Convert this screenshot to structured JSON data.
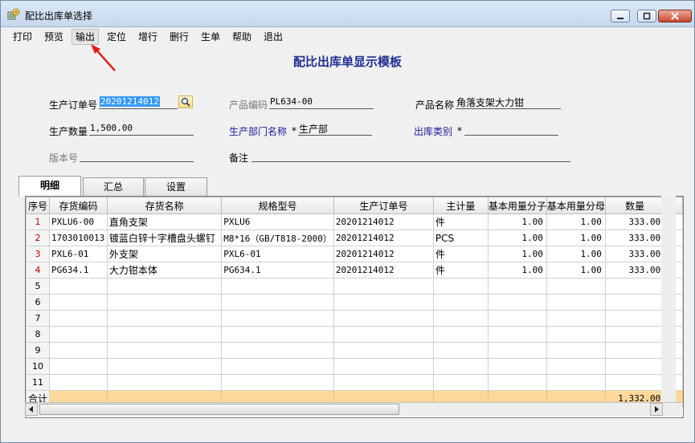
{
  "window": {
    "title": "配比出库单选择"
  },
  "menu": [
    "打印",
    "预览",
    "输出",
    "定位",
    "增行",
    "删行",
    "生单",
    "帮助",
    "退出"
  ],
  "active_menu": "输出",
  "heading": "配比出库单显示模板",
  "form": {
    "order_no_label": "生产订单号",
    "order_no_value": "20201214012",
    "product_code_label": "产品编码",
    "product_code_value": "PL634-00",
    "product_name_label": "产品名称",
    "product_name_value": "角落支架大力钳",
    "qty_label": "生产数量",
    "qty_value": "1,500.00",
    "dept_label": "生产部门名称",
    "dept_value": "生产部",
    "out_type_label": "出库类别",
    "required_mark": "*",
    "version_label": "版本号",
    "remark_label": "备注"
  },
  "tabs": [
    "明细",
    "汇总",
    "设置"
  ],
  "grid": {
    "columns": [
      "序号",
      "存货编码",
      "存货名称",
      "规格型号",
      "生产订单号",
      "主计量",
      "基本用量分子",
      "基本用量分母",
      "数量"
    ],
    "rows": [
      [
        "1",
        "PXLU6-00",
        "直角支架",
        "PXLU6",
        "20201214012",
        "件",
        "1.00",
        "1.00",
        "333.00"
      ],
      [
        "2",
        "1703010013",
        "镀蓝白锌十字槽盘头螺钉",
        "M8*16（GB/T818-2000）",
        "20201214012",
        "PCS",
        "1.00",
        "1.00",
        "333.00"
      ],
      [
        "3",
        "PXL6-01",
        "外支架",
        "PXL6-01",
        "20201214012",
        "件",
        "1.00",
        "1.00",
        "333.00"
      ],
      [
        "4",
        "PG634.1",
        "大力钳本体",
        "PG634.1",
        "20201214012",
        "件",
        "1.00",
        "1.00",
        "333.00"
      ],
      [
        "5",
        "",
        "",
        "",
        "",
        "",
        "",
        "",
        ""
      ],
      [
        "6",
        "",
        "",
        "",
        "",
        "",
        "",
        "",
        ""
      ],
      [
        "7",
        "",
        "",
        "",
        "",
        "",
        "",
        "",
        ""
      ],
      [
        "8",
        "",
        "",
        "",
        "",
        "",
        "",
        "",
        ""
      ],
      [
        "9",
        "",
        "",
        "",
        "",
        "",
        "",
        "",
        ""
      ],
      [
        "10",
        "",
        "",
        "",
        "",
        "",
        "",
        "",
        ""
      ],
      [
        "11",
        "",
        "",
        "",
        "",
        "",
        "",
        "",
        ""
      ]
    ],
    "total_label": "合计",
    "total_qty": "1,332.00"
  }
}
